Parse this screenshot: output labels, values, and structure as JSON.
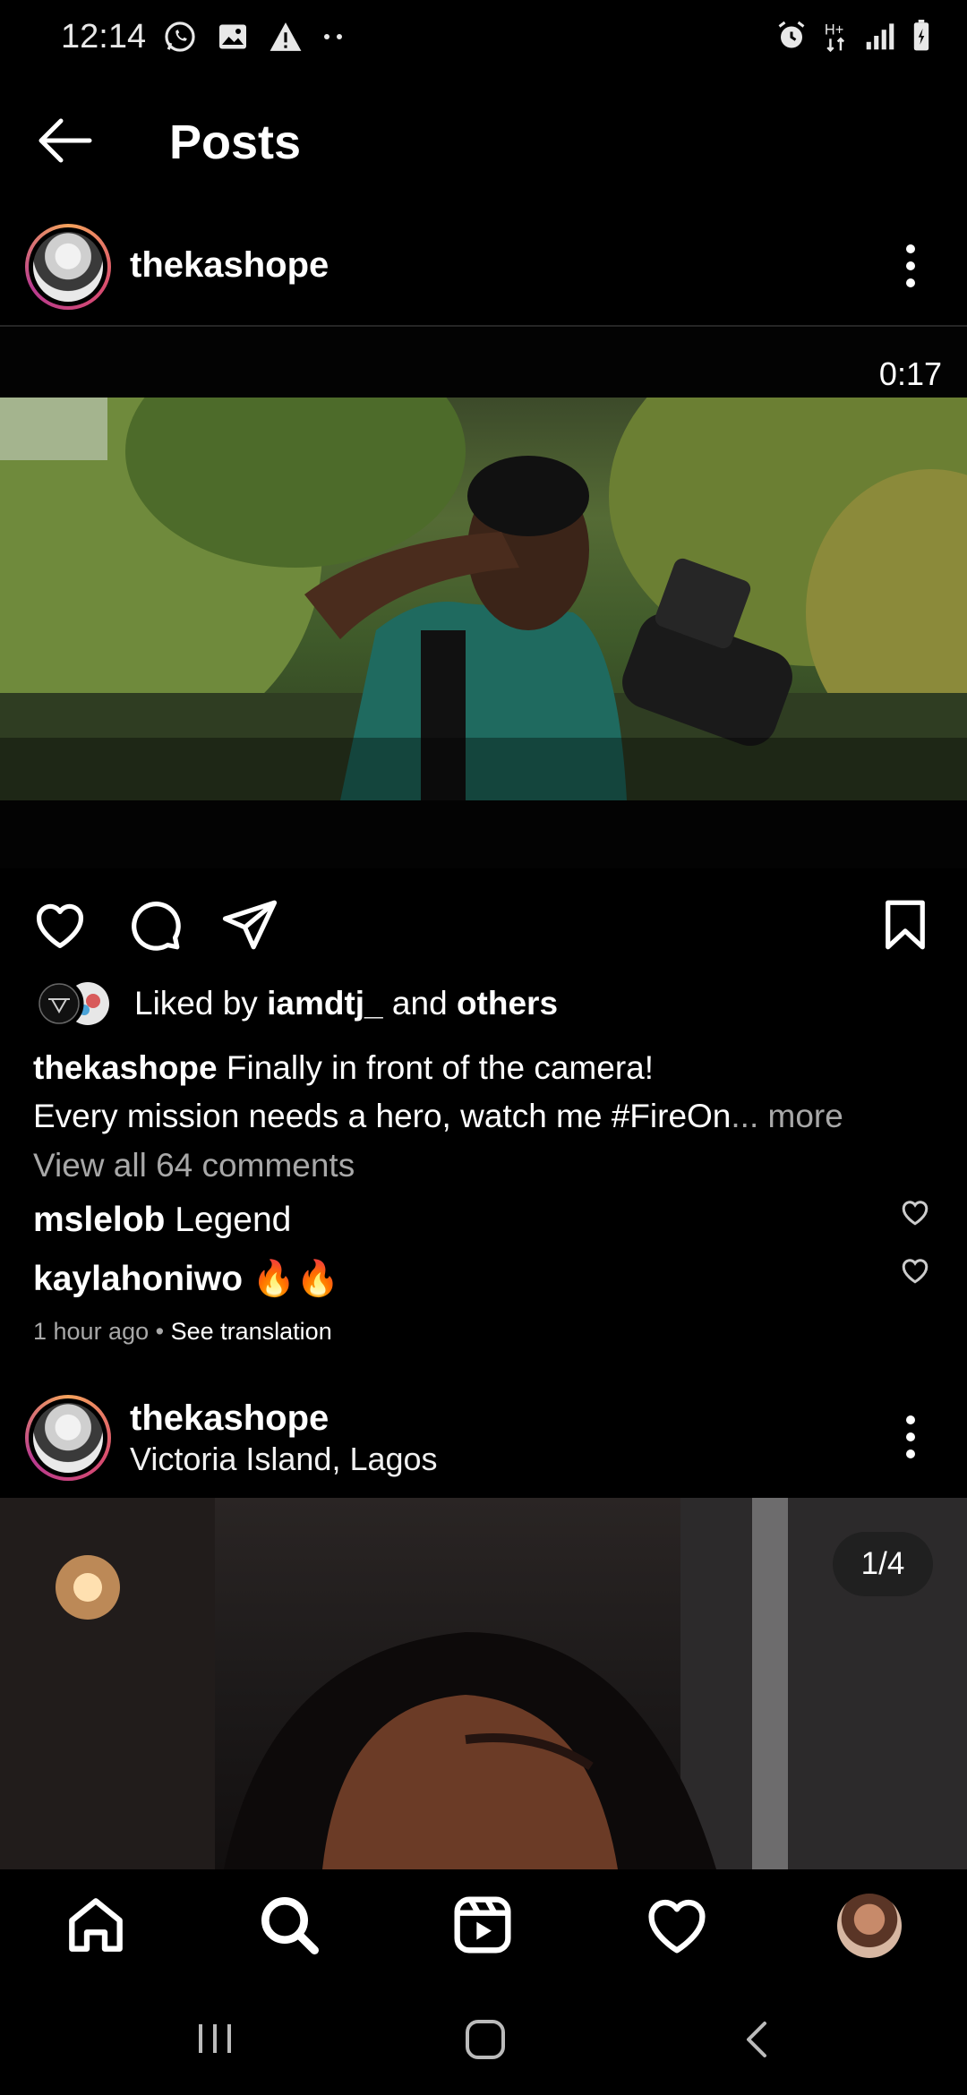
{
  "status_bar": {
    "time": "12:14",
    "left_icons": [
      "whatsapp-icon",
      "gallery-icon",
      "warning-icon",
      "more-dots-icon"
    ],
    "right_icons": [
      "alarm-icon",
      "hplus-network-icon",
      "signal-icon",
      "battery-icon"
    ]
  },
  "header": {
    "title": "Posts"
  },
  "post1": {
    "username": "thekashope",
    "video_duration": "0:17",
    "liked_by_prefix": "Liked by",
    "liked_by_user": "iamdtj_",
    "liked_by_and": "and",
    "liked_by_others": "others",
    "caption_user": "thekashope",
    "caption_line1": "Finally in front of the camera!",
    "caption_line2": "Every mission needs a hero, watch me #FireOn",
    "caption_ellipsis": "...",
    "caption_more": "more",
    "view_comments": "View all 64 comments",
    "comments": [
      {
        "user": "mslelob",
        "text": "Legend"
      },
      {
        "user": "kaylahoniwo",
        "text": "🔥🔥"
      }
    ],
    "time_ago": "1 hour ago",
    "separator": "•",
    "see_translation": "See translation"
  },
  "post2": {
    "username": "thekashope",
    "location": "Victoria Island, Lagos",
    "image_counter": "1/4"
  },
  "bottom_nav": {
    "items": [
      "home-icon",
      "search-icon",
      "reels-icon",
      "activity-heart-icon",
      "profile-avatar"
    ]
  }
}
